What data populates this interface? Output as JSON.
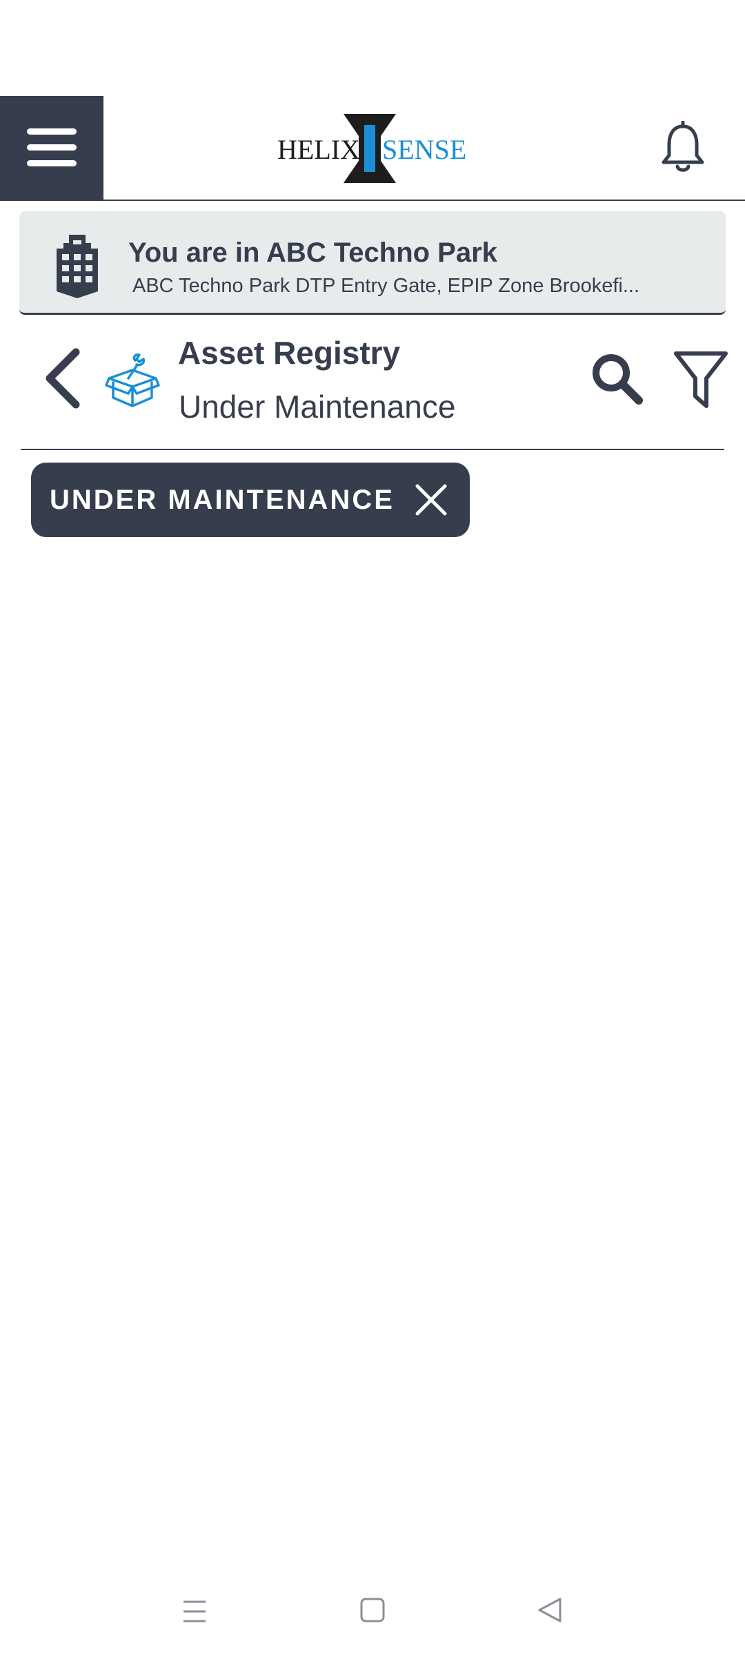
{
  "header": {
    "logo_left": "HELIX",
    "logo_right": "SENSE",
    "menu_icon": "hamburger-menu-icon",
    "bell_icon": "bell-icon"
  },
  "location": {
    "title": "You are in ABC Techno Park",
    "address": "ABC Techno Park DTP Entry Gate, EPIP Zone Brookefi...",
    "icon": "building-icon"
  },
  "page": {
    "title": "Asset Registry",
    "subtitle": "Under Maintenance",
    "back_icon": "chevron-left-icon",
    "module_icon": "box-wrench-icon",
    "search_icon": "search-icon",
    "filter_icon": "filter-icon"
  },
  "filter_chip": {
    "label": "UNDER MAINTENANCE",
    "close_icon": "close-icon"
  },
  "colors": {
    "primary": "#363d4d",
    "accent": "#1a8fd6",
    "banner_bg": "#e8ebec"
  }
}
